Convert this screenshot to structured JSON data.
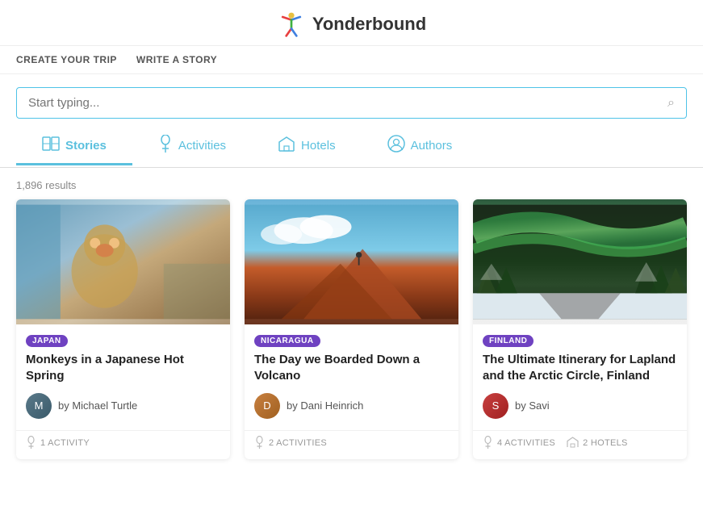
{
  "header": {
    "logo_text": "Yonderbound"
  },
  "nav": {
    "items": [
      {
        "id": "create-trip",
        "label": "CREATE YOUR TRIP"
      },
      {
        "id": "write-story",
        "label": "WRITE A STORY"
      }
    ]
  },
  "search": {
    "placeholder": "Start typing..."
  },
  "tabs": [
    {
      "id": "stories",
      "label": "Stories",
      "icon": "📖",
      "active": true
    },
    {
      "id": "activities",
      "label": "Activities",
      "icon": "💡",
      "active": false
    },
    {
      "id": "hotels",
      "label": "Hotels",
      "icon": "🏠",
      "active": false
    },
    {
      "id": "authors",
      "label": "Authors",
      "icon": "👤",
      "active": false
    }
  ],
  "results": {
    "count": "1,896 results"
  },
  "cards": [
    {
      "id": "card-1",
      "country": "JAPAN",
      "title": "Monkeys in a Japanese Hot Spring",
      "author": "Michael Turtle",
      "image_type": "monkey",
      "footer": [
        {
          "icon": "💡",
          "text": "1 ACTIVITY"
        }
      ]
    },
    {
      "id": "card-2",
      "country": "NICARAGUA",
      "title": "The Day we Boarded Down a Volcano",
      "author": "Dani Heinrich",
      "image_type": "volcano",
      "footer": [
        {
          "icon": "💡",
          "text": "2 ACTIVITIES"
        }
      ]
    },
    {
      "id": "card-3",
      "country": "FINLAND",
      "title": "The Ultimate Itinerary for Lapland and the Arctic Circle, Finland",
      "author": "Savi",
      "image_type": "aurora",
      "footer": [
        {
          "icon": "💡",
          "text": "4 ACTIVITIES"
        },
        {
          "icon": "🏠",
          "text": "2 HOTELS"
        }
      ]
    }
  ]
}
